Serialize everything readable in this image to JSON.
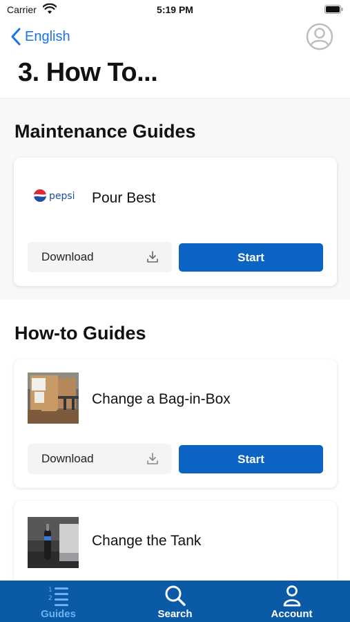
{
  "status_bar": {
    "carrier": "Carrier",
    "time": "5:19 PM"
  },
  "nav": {
    "back_label": "English"
  },
  "page": {
    "title": "3. How To..."
  },
  "sections": [
    {
      "heading": "Maintenance Guides",
      "cards": [
        {
          "title": "Pour Best",
          "thumb": "pepsi-logo",
          "download_label": "Download",
          "start_label": "Start"
        }
      ]
    },
    {
      "heading": "How-to Guides",
      "cards": [
        {
          "title": "Change a Bag-in-Box",
          "thumb": "bag-in-box-photo",
          "download_label": "Download",
          "start_label": "Start"
        },
        {
          "title": "Change the  Tank",
          "thumb": "tank-photo"
        }
      ]
    }
  ],
  "tabs": [
    {
      "label": "Guides",
      "icon": "numbered-list-icon",
      "active": true
    },
    {
      "label": "Search",
      "icon": "search-icon",
      "active": false
    },
    {
      "label": "Account",
      "icon": "person-icon",
      "active": false
    }
  ],
  "colors": {
    "accent": "#1a73e8",
    "primary_button": "#0b63c4",
    "tab_bar": "#0b5aa8",
    "tab_active": "#6fb2f2"
  }
}
